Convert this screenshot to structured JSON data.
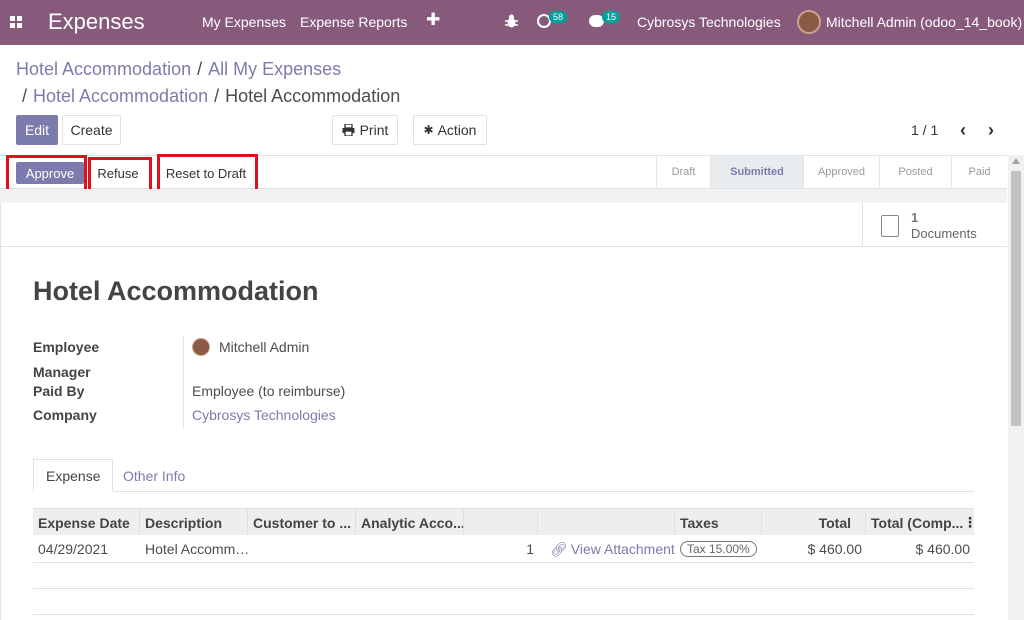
{
  "navbar": {
    "app_title": "Expenses",
    "menu": [
      "My Expenses",
      "Expense Reports"
    ],
    "plus": "✚",
    "activity_count": "58",
    "message_count": "15",
    "company": "Cybrosys Technologies",
    "user": "Mitchell Admin (odoo_14_book)"
  },
  "breadcrumb": {
    "line1": [
      "Hotel Accommodation",
      "All My Expenses"
    ],
    "line2": [
      "Hotel Accommodation",
      "Hotel Accommodation"
    ]
  },
  "controls": {
    "edit": "Edit",
    "create": "Create",
    "print": "Print",
    "action": "Action",
    "pager": "1 / 1"
  },
  "statusbar": {
    "approve": "Approve",
    "refuse": "Refuse",
    "reset": "Reset to Draft",
    "stages": [
      "Draft",
      "Submitted",
      "Approved",
      "Posted",
      "Paid"
    ],
    "active_stage": "Submitted"
  },
  "smart_button": {
    "count": "1",
    "label": "Documents"
  },
  "record": {
    "title": "Hotel Accommodation",
    "fields": {
      "employee_label": "Employee",
      "employee": "Mitchell Admin",
      "manager_label": "Manager",
      "paid_by_label": "Paid By",
      "paid_by": "Employee (to reimburse)",
      "company_label": "Company",
      "company": "Cybrosys Technologies"
    }
  },
  "tabs": [
    "Expense",
    "Other Info"
  ],
  "table": {
    "headers": [
      "Expense Date",
      "Description",
      "Customer to ...",
      "Analytic Acco...",
      "",
      "",
      "Taxes",
      "Total",
      "Total (Comp..."
    ],
    "rows": [
      {
        "date": "04/29/2021",
        "description": "Hotel Accomm…",
        "qty": "1",
        "attachments": "View Attachments",
        "tax": "Tax 15.00%",
        "total": "$ 460.00",
        "total_company": "$ 460.00"
      }
    ]
  },
  "colors": {
    "navbar": "#875a7b",
    "primary": "#7c7bad",
    "highlight_box": "#e0101c"
  }
}
